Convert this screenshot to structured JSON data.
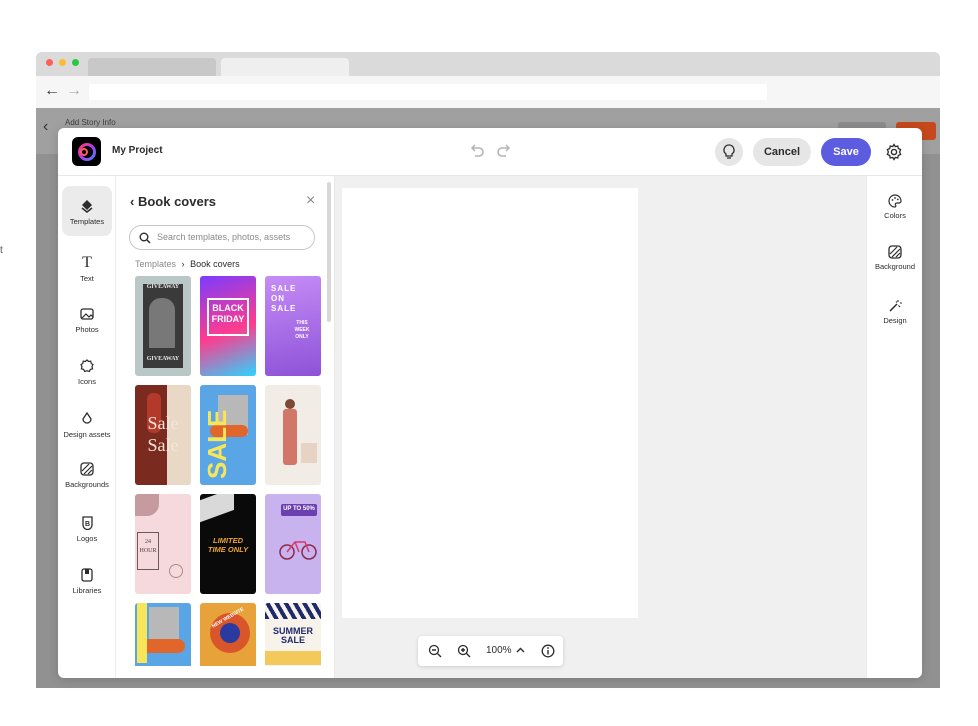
{
  "browser": {
    "back_arrow": "←",
    "forward_arrow": "→"
  },
  "background_page": {
    "title": "Add Story Info",
    "back_glyph": "‹"
  },
  "editor": {
    "project_name": "My Project",
    "cancel_label": "Cancel",
    "save_label": "Save",
    "accent_color": "#5c5ce0"
  },
  "left_rail": {
    "items": [
      {
        "label": "Templates",
        "icon": "templates-icon"
      },
      {
        "label": "Text",
        "icon": "text-icon"
      },
      {
        "label": "Photos",
        "icon": "photos-icon"
      },
      {
        "label": "Icons",
        "icon": "icons-icon"
      },
      {
        "label": "Design assets",
        "icon": "design-assets-icon"
      },
      {
        "label": "Backgrounds",
        "icon": "backgrounds-icon"
      },
      {
        "label": "Logos",
        "icon": "logos-icon"
      },
      {
        "label": "Libraries",
        "icon": "libraries-icon"
      }
    ]
  },
  "panel": {
    "title": "Book covers",
    "search_placeholder": "Search templates, photos, assets",
    "breadcrumb": {
      "root": "Templates",
      "current": "Book covers"
    },
    "thumbnails": [
      {
        "name": "giveaway",
        "text": "GIVEAWAY"
      },
      {
        "name": "black-friday",
        "text": "BLACK FRIDAY"
      },
      {
        "name": "sale-on-sale",
        "text": "SALE ON SALE",
        "subtext": "THIS WEEK ONLY"
      },
      {
        "name": "sale-red",
        "text": "Sale"
      },
      {
        "name": "sale-yellow",
        "text": "SALE"
      },
      {
        "name": "model-pink",
        "text": ""
      },
      {
        "name": "floral-24-hour",
        "text": "24 HOUR"
      },
      {
        "name": "limited-time",
        "text": "LIMITED TIME ONLY"
      },
      {
        "name": "bike-sale",
        "text": "UP TO 50%"
      },
      {
        "name": "sunglasses",
        "text": ""
      },
      {
        "name": "new-website",
        "text": "NEW WEBSITE"
      },
      {
        "name": "summer-sale",
        "text": "SUMMER SALE"
      }
    ]
  },
  "zoom": {
    "level": "100%"
  },
  "right_rail": {
    "items": [
      {
        "label": "Colors",
        "icon": "colors-icon"
      },
      {
        "label": "Background",
        "icon": "background-icon"
      },
      {
        "label": "Design",
        "icon": "design-icon"
      }
    ]
  }
}
